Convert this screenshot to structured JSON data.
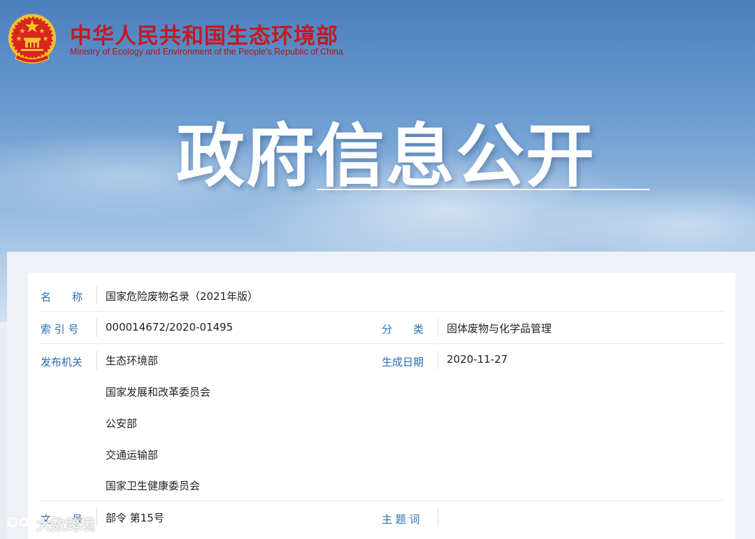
{
  "header": {
    "site_name": "中华人民共和国生态环境部",
    "site_name_en": "Ministry of Ecology and Environment of the People's Republic of China"
  },
  "hero": {
    "title": "政府信息公开"
  },
  "doc": {
    "name_label": "名　　称",
    "name": "国家危险废物名录（2021年版）",
    "index_label": "索 引 号",
    "index": "000014672/2020-01495",
    "category_label": "分　　类",
    "category": "固体废物与化学品管理",
    "issuer_label": "发布机关",
    "issuers": [
      "生态环境部",
      "国家发展和改革委员会",
      "公安部",
      "交通运输部",
      "国家卫生健康委员会"
    ],
    "date_label": "生成日期",
    "date": "2020-11-27",
    "docno_label": "文　　号",
    "docno": "部令 第15号",
    "subject_label": "主 题 词",
    "subject": ""
  },
  "watermark": {
    "text": "大数跨境"
  },
  "colors": {
    "brand_red": "#c3191f",
    "label_blue": "#2a6db5",
    "emblem_red": "#d7261e",
    "emblem_gold": "#f6c22b"
  },
  "icons": {
    "emblem": "national-emblem-icon",
    "watermark": "wechat-channel-icon"
  }
}
